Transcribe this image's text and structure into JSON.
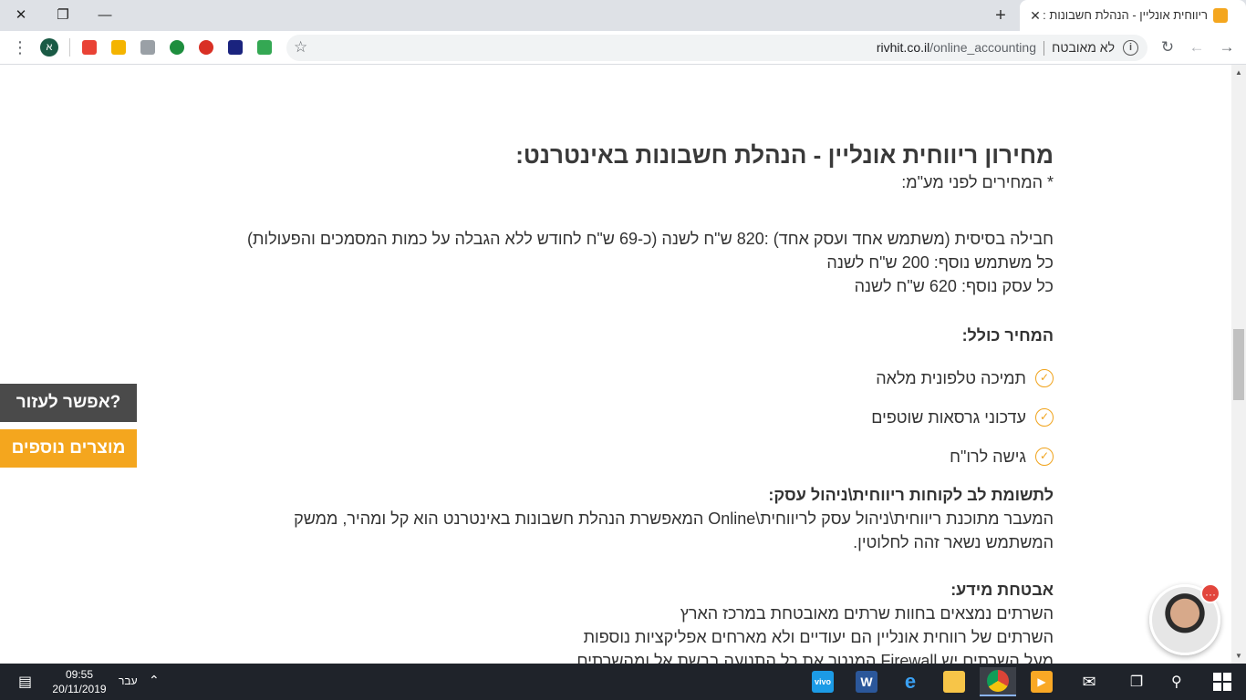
{
  "browser": {
    "tab_title": "ריווחית אונליין - הנהלת חשבונות :",
    "tab_close": "✕",
    "new_tab": "+",
    "window_close": "✕",
    "window_max": "❐",
    "window_min": "—",
    "secure_label": "לא מאובטח",
    "url_domain": "rivhit.co.il",
    "url_path": "/online_accounting",
    "profile_initial": "א",
    "extensions": [
      "colorful-grid-icon",
      "coins-icon",
      "image-icon",
      "green-pin-icon",
      "red-circle-icon",
      "a-letter-icon",
      "cloud-icon"
    ],
    "ext_colors": [
      "#e94235",
      "#f4b400",
      "#9aa0a6",
      "#1e8e3e",
      "#d93025",
      "#1a237e",
      "#34a853"
    ]
  },
  "content": {
    "title": "מחירון ריווחית אונליין - הנהלת חשבונות באינטרנט:",
    "vat_note": "* המחירים לפני מע\"מ:",
    "pricing": [
      "חבילה בסיסית (משתמש אחד ועסק אחד) :820 ש\"ח לשנה (כ-69 ש\"ח לחודש ללא הגבלה על כמות המסמכים והפעולות)",
      "כל משתמש נוסף: 200 ש\"ח לשנה",
      "כל עסק נוסף: 620 ש\"ח לשנה"
    ],
    "includes_heading": "המחיר כולל:",
    "includes": [
      "תמיכה טלפונית מלאה",
      "עדכוני גרסאות שוטפים",
      "גישה לרו\"ח"
    ],
    "attention_heading": "לתשומת לב לקוחות ריווחית\\ניהול עסק:",
    "attention_text": "המעבר מתוכנת ריווחית\\ניהול עסק לריווחית\\Online המאפשרת הנהלת חשבונות באינטרנט הוא קל ומהיר, ממשק המשתמש נשאר זהה לחלוטין.",
    "security_heading": "אבטחת מידע:",
    "security_lines": [
      "השרתים נמצאים בחוות שרתים מאובטחת במרכז הארץ",
      "השרתים של רווחית אונליין הם יעודיים ולא מארחים אפליקציות נוספות",
      "מעל השרתים יש Firewall המנטר את כל התנועה ברשת אל ומהשרתים"
    ]
  },
  "side_buttons": {
    "help": "אפשר לעזור?",
    "more_products": "מוצרים נוספים"
  },
  "chat": {
    "badge": "···"
  },
  "taskbar": {
    "time": "09:55",
    "date": "20/11/2019",
    "lang": "עבר",
    "apps": [
      "vivo",
      "word",
      "edge",
      "file-explorer",
      "chrome",
      "video-player",
      "mail",
      "task-view"
    ]
  }
}
